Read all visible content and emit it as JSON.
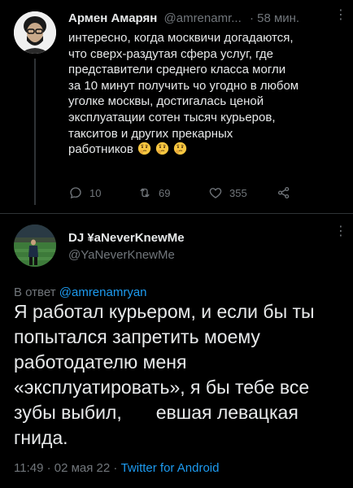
{
  "tweet1": {
    "author_name": "Армен Амарян",
    "author_handle": "@amrenamr...",
    "timestamp": "· 58 мин.",
    "text": "интересно, когда москвичи догадаются,\nчто сверх-раздутая сфера услуг, где\nпредставители среднего класса могли\nза 10 минут получить чо угодно в любом\nуголке москвы, достигалась ценой\nэксплуатации сотен тысяч курьеров,\nтакситов и других прекарных\nработников",
    "emojis": [
      "thinking-face",
      "thinking-face",
      "thinking-face"
    ],
    "actions": {
      "replies": "10",
      "retweets": "69",
      "likes": "355"
    }
  },
  "tweet2": {
    "author_name": "DJ ¥aNeverKnewMe",
    "author_handle": "@YaNeverKnewMe",
    "reply_prefix": "В ответ ",
    "reply_mention": "@amrenamryan",
    "text_part1": "Я работал курьером, и если бы ты попытался запретить моему работодателю меня «эксплуатировать», я бы тебе все зубы выбил,",
    "text_part2": "евшая левацкая гнида.",
    "meta_time": "11:49 · 02 мая 22 · ",
    "meta_client": "Twitter for Android"
  },
  "colors": {
    "background": "#000000",
    "text": "#e7e9ea",
    "secondary": "#71767b",
    "accent": "#1d9bf0",
    "divider": "#2f3336"
  }
}
